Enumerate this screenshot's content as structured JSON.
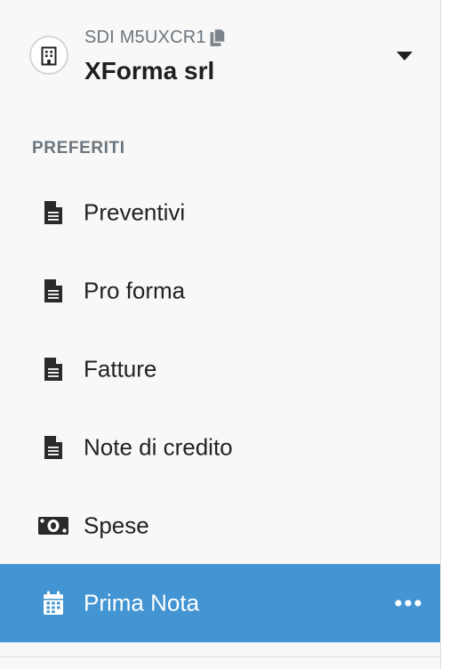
{
  "company": {
    "sdi_code": "SDI M5UXCR1",
    "name": "XForma srl",
    "avatar_icon": "building-icon",
    "copy_icon": "copy-icon",
    "dropdown_icon": "caret-down-icon"
  },
  "favorites": {
    "heading": "PREFERITI",
    "items": [
      {
        "label": "Preventivi",
        "icon": "document-icon"
      },
      {
        "label": "Pro forma",
        "icon": "document-icon"
      },
      {
        "label": "Fatture",
        "icon": "document-icon"
      },
      {
        "label": "Note di credito",
        "icon": "document-icon"
      },
      {
        "label": "Spese",
        "icon": "money-bill-icon"
      },
      {
        "label": "Prima Nota",
        "icon": "calendar-icon",
        "active": true
      }
    ]
  },
  "colors": {
    "active_background": "#4394d2",
    "sidebar_background": "#f8f8f8",
    "muted_text": "#6c757d"
  }
}
